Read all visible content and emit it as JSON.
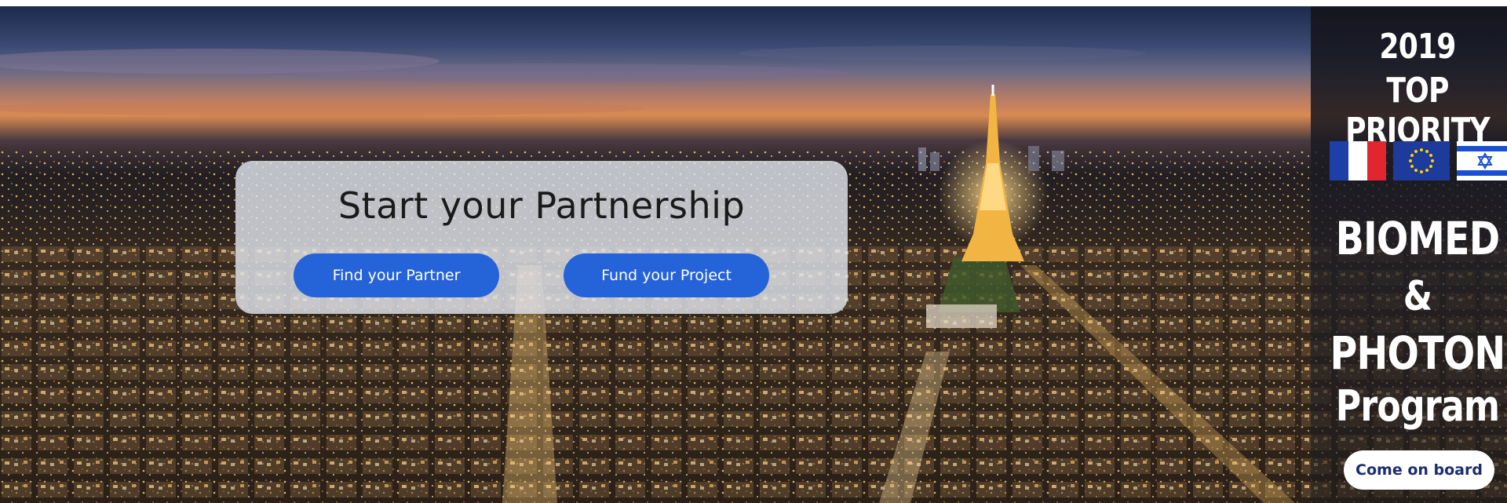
{
  "hero": {
    "image": "paris-skyline-night-eiffel-tower",
    "card": {
      "title": "Start your Partnership",
      "buttons": [
        {
          "label": "Find your Partner"
        },
        {
          "label": "Fund your Project"
        }
      ],
      "button_color": "#2563d9"
    }
  },
  "promo": {
    "year": "2019",
    "headline": "TOP PRIORITY",
    "flags": [
      "france-flag",
      "eu-flag",
      "israel-flag"
    ],
    "line1": "BIOMED",
    "line2": "&",
    "line3": "PHOTONICS",
    "line4": "Program",
    "cta_label": "Come on board",
    "cta_text_color": "#1b2d6e"
  }
}
